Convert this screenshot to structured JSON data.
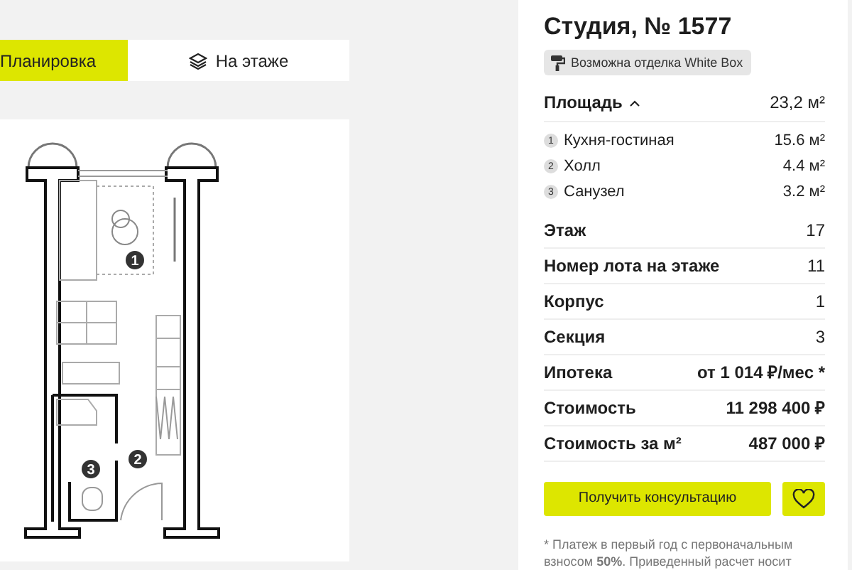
{
  "tabs": [
    {
      "label": "Планировка",
      "selected": true,
      "kind": "plain"
    },
    {
      "label": "На этаже",
      "selected": false,
      "kind": "layers"
    }
  ],
  "plan": {
    "markers": [
      {
        "label": "1"
      },
      {
        "label": "2"
      },
      {
        "label": "3"
      }
    ]
  },
  "title": "Студия, № 1577",
  "finish_badge": "Возможна отделка White Box",
  "area": {
    "label": "Площадь",
    "expanded": true,
    "value": "23,2 м²",
    "rooms": [
      {
        "number": "1",
        "name": "Кухня-гостиная",
        "value": "15.6 м²"
      },
      {
        "number": "2",
        "name": "Холл",
        "value": "4.4 м²"
      },
      {
        "number": "3",
        "name": "Санузел",
        "value": "3.2 м²"
      }
    ]
  },
  "details": [
    {
      "label": "Этаж",
      "value": "17",
      "emphasis": false
    },
    {
      "label": "Номер лота на этаже",
      "value": "11",
      "emphasis": false
    },
    {
      "label": "Корпус",
      "value": "1",
      "emphasis": false
    },
    {
      "label": "Секция",
      "value": "3",
      "emphasis": false
    },
    {
      "label": "Ипотека",
      "value": "от 1 014 ₽/мес *",
      "emphasis": true
    },
    {
      "label": "Стоимость",
      "value": "11 298 400 ₽",
      "emphasis": true
    },
    {
      "label": "Стоимость за м²",
      "value": "487 000 ₽",
      "emphasis": true
    }
  ],
  "consult_button": "Получить консультацию",
  "footnote": "* Платеж в первый год с первоначальным взносом **50%**. Приведенный расчет носит"
}
